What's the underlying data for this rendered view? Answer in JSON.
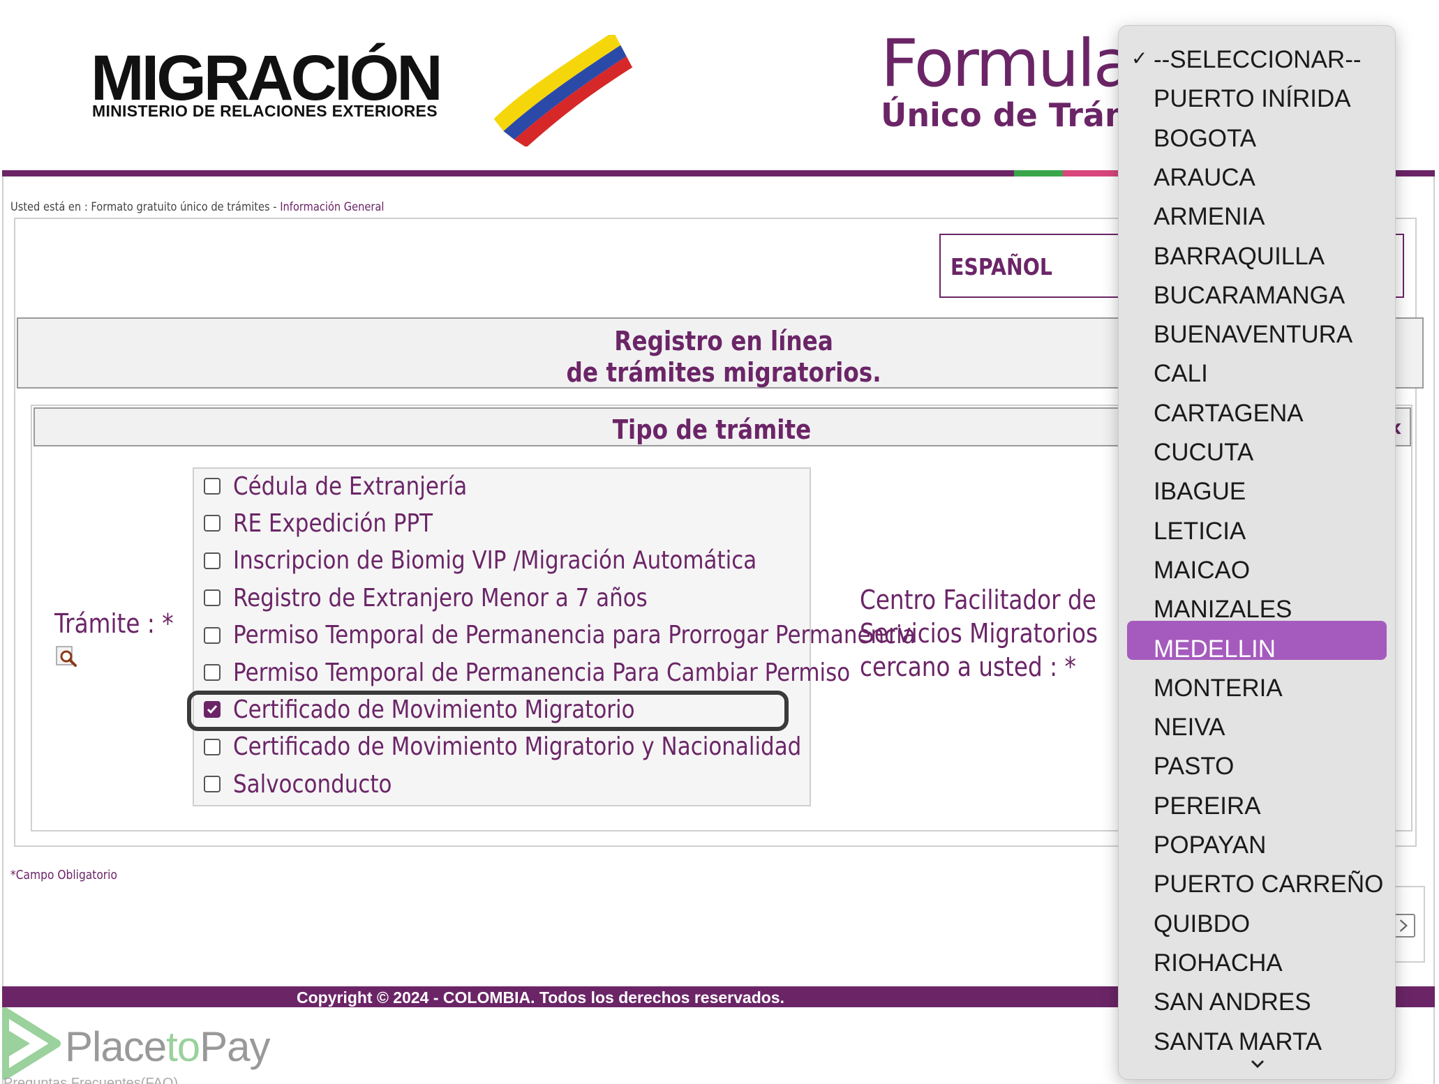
{
  "header": {
    "logo_text": "MIGRACIÓN",
    "logo_subtitle": "MINISTERIO DE RELACIONES EXTERIORES",
    "form_title_line1": "Formular",
    "form_title_line2": "Único de Trámi"
  },
  "breadcrumb": {
    "prefix": "Usted está en : Formato gratuito único de trámites - ",
    "current": "Información General"
  },
  "language": {
    "selected": "ESPAÑOL"
  },
  "section": {
    "title_line1": "Registro en línea",
    "title_line2": "de trámites migratorios."
  },
  "tipo": {
    "header": "Tipo de trámite",
    "close_glyph": "x",
    "tramite_label": "Trámite : *",
    "options": [
      {
        "label": "Cédula de Extranjería",
        "checked": false
      },
      {
        "label": "RE Expedición PPT",
        "checked": false
      },
      {
        "label": "Inscripcion de Biomig VIP /Migración Automática",
        "checked": false
      },
      {
        "label": "Registro de Extranjero Menor a 7 años",
        "checked": false
      },
      {
        "label": "Permiso Temporal de Permanencia para Prorrogar Permanencia",
        "checked": false
      },
      {
        "label": "Permiso Temporal de Permanencia Para Cambiar Permiso",
        "checked": false
      },
      {
        "label": "Certificado de Movimiento Migratorio",
        "checked": true
      },
      {
        "label": "Certificado de Movimiento Migratorio y Nacionalidad",
        "checked": false
      },
      {
        "label": "Salvoconducto",
        "checked": false
      }
    ],
    "centro_label": "Centro Facilitador de Servicios Migratorios cercano a usted : *"
  },
  "campo_obligatorio": "*Campo Obligatorio",
  "footer": {
    "copyright": "Copyright © 2024 - COLOMBIA. Todos los derechos reservados."
  },
  "placetopay": {
    "brand_a": "Place",
    "brand_b": "to",
    "brand_c": "Pay"
  },
  "faq": "Preguntas Frecuentes(FAQ)",
  "dropdown": {
    "selected_check": "✓",
    "options": [
      "--SELECCIONAR--",
      "PUERTO INÍRIDA",
      "BOGOTA",
      "ARAUCA",
      "ARMENIA",
      "BARRAQUILLA",
      "BUCARAMANGA",
      "BUENAVENTURA",
      "CALI",
      "CARTAGENA",
      "CUCUTA",
      "IBAGUE",
      "LETICIA",
      "MAICAO",
      "MANIZALES",
      "MEDELLIN",
      "MONTERIA",
      "NEIVA",
      "PASTO",
      "PEREIRA",
      "POPAYAN",
      "PUERTO CARREÑO",
      "QUIBDO",
      "RIOHACHA",
      "SAN ANDRES",
      "SANTA MARTA"
    ],
    "checked_option": "--SELECCIONAR--",
    "highlighted_option": "MEDELLIN"
  },
  "colors": {
    "brand_purple": "#6b2567",
    "highlight": "#a55bbd",
    "flag_yellow": "#f5d60a",
    "flag_blue": "#2b4aa8",
    "flag_red": "#d62828"
  }
}
